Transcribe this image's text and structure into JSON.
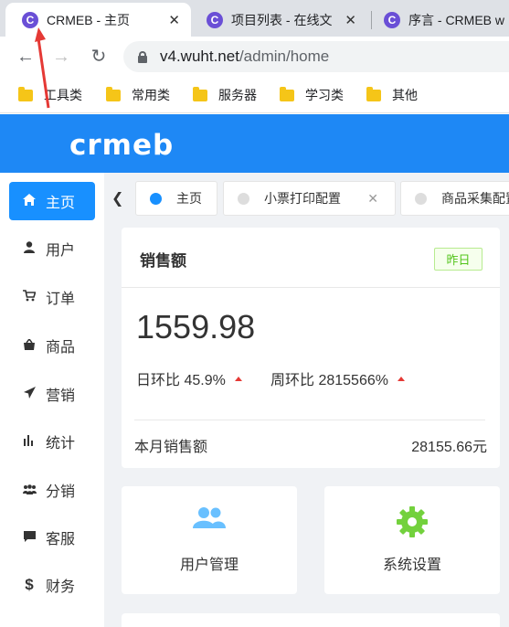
{
  "browser": {
    "tabs": [
      {
        "title": "CRMEB - 主页",
        "active": true
      },
      {
        "title": "项目列表 - 在线文",
        "active": false
      },
      {
        "title": "序言 - CRMEB w",
        "active": false
      }
    ],
    "tab_favicon_letter": "C",
    "url_host": "v4.wuht.net",
    "url_path": "/admin/home",
    "bookmarks": [
      "工具类",
      "常用类",
      "服务器",
      "学习类",
      "其他"
    ]
  },
  "app": {
    "logo": "crmeb",
    "brand_color": "#1e88f5",
    "menu": [
      {
        "label": "主页",
        "icon": "home-icon",
        "active": true
      },
      {
        "label": "用户",
        "icon": "user-icon"
      },
      {
        "label": "订单",
        "icon": "cart-icon"
      },
      {
        "label": "商品",
        "icon": "shop-icon"
      },
      {
        "label": "营销",
        "icon": "send-icon"
      },
      {
        "label": "统计",
        "icon": "bar-chart-icon"
      },
      {
        "label": "分销",
        "icon": "team-icon"
      },
      {
        "label": "客服",
        "icon": "chat-icon"
      },
      {
        "label": "财务",
        "icon": "dollar-icon"
      }
    ],
    "tags": [
      {
        "label": "主页",
        "active": true
      },
      {
        "label": "小票打印配置",
        "closable": true
      },
      {
        "label": "商品采集配置"
      }
    ],
    "sales": {
      "title": "销售额",
      "badge": "昨日",
      "amount": "1559.98",
      "day_ratio_label": "日环比 45.9%",
      "week_ratio_label": "周环比 2815566%",
      "month_label": "本月销售额",
      "month_value": "28155.66元"
    },
    "quick": [
      {
        "label": "用户管理",
        "icon": "users-icon",
        "color": "#69c0ff"
      },
      {
        "label": "系统设置",
        "icon": "gear-icon",
        "color": "#73d13d"
      }
    ]
  }
}
